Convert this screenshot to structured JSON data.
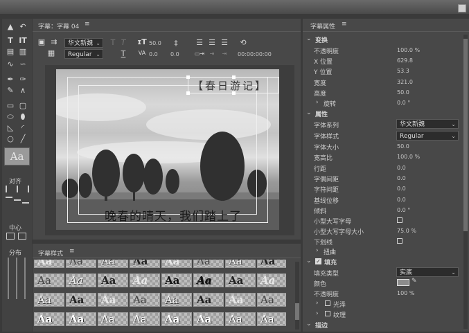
{
  "title_panel": {
    "title": "字幕：字幕 04",
    "menu_icon": "≡"
  },
  "toolbar": {
    "font_family": "华文新魏",
    "font_style": "Regular",
    "font_size": "50.0",
    "kerning": "0.0",
    "leading": "0.0",
    "timecode": "00:00:00:00"
  },
  "canvas": {
    "top_text": "【春日游记】",
    "subtitle": "晚春的晴天，我们踏上了"
  },
  "tools": {
    "align_label": "对齐",
    "center_label": "中心",
    "distribute_label": "分布",
    "style_preview": "Aa"
  },
  "styles_panel": {
    "title": "字幕样式",
    "menu_icon": "≡",
    "sample": "Aa",
    "sample_count": 32
  },
  "properties": {
    "title": "字幕属性",
    "menu_icon": "≡",
    "transform": {
      "header": "变换",
      "rows": [
        {
          "label": "不透明度",
          "value": "100.0 %"
        },
        {
          "label": "X 位置",
          "value": "629.8"
        },
        {
          "label": "Y 位置",
          "value": "53.3"
        },
        {
          "label": "宽度",
          "value": "321.0"
        },
        {
          "label": "高度",
          "value": "50.0"
        }
      ],
      "rotation_label": "旋转",
      "rotation_value": "0.0 °"
    },
    "attributes": {
      "header": "属性",
      "font_family_label": "字体系列",
      "font_family_value": "华文新魏",
      "font_style_label": "字体样式",
      "font_style_value": "Regular",
      "rows": [
        {
          "label": "字体大小",
          "value": "50.0"
        },
        {
          "label": "宽高比",
          "value": "100.0 %"
        },
        {
          "label": "行距",
          "value": "0.0"
        },
        {
          "label": "字偶间距",
          "value": "0.0"
        },
        {
          "label": "字符间距",
          "value": "0.0"
        },
        {
          "label": "基线位移",
          "value": "0.0"
        },
        {
          "label": "倾斜",
          "value": "0.0 °"
        }
      ],
      "smallcaps_label": "小型大写字母",
      "smallcaps_size_label": "小型大写字母大小",
      "smallcaps_size_value": "75.0 %",
      "underline_label": "下划线",
      "distort_label": "扭曲"
    },
    "fill": {
      "header": "填充",
      "fill_type_label": "填充类型",
      "fill_type_value": "实底",
      "color_label": "颜色",
      "opacity_label": "不透明度",
      "opacity_value": "100 %",
      "sheen_label": "光泽",
      "texture_label": "纹理"
    },
    "stroke": {
      "header": "描边"
    }
  }
}
